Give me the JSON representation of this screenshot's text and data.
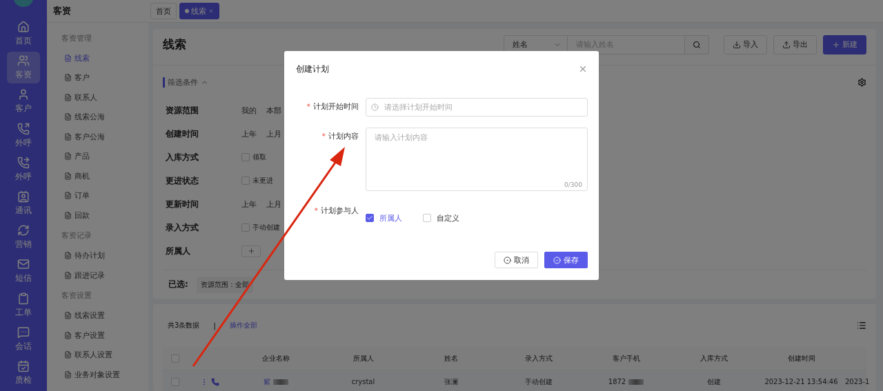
{
  "nav": [
    {
      "label": "首页",
      "selected": false
    },
    {
      "label": "客资",
      "selected": true
    },
    {
      "label": "客户",
      "selected": false
    },
    {
      "label": "外呼",
      "selected": false
    },
    {
      "label": "外呼",
      "selected": false
    },
    {
      "label": "通讯",
      "selected": false
    },
    {
      "label": "营销",
      "selected": false
    },
    {
      "label": "短信",
      "selected": false
    },
    {
      "label": "工单",
      "selected": false
    },
    {
      "label": "会话",
      "selected": false
    },
    {
      "label": "质检",
      "selected": false
    }
  ],
  "sidebar": {
    "title": "客资",
    "groups": [
      {
        "title": "客资管理",
        "items": [
          {
            "label": "线索",
            "selected": true
          },
          {
            "label": "客户",
            "selected": false
          },
          {
            "label": "联系人",
            "selected": false
          },
          {
            "label": "线索公海",
            "selected": false
          },
          {
            "label": "客户公海",
            "selected": false
          },
          {
            "label": "产品",
            "selected": false
          },
          {
            "label": "商机",
            "selected": false
          },
          {
            "label": "订单",
            "selected": false
          },
          {
            "label": "回款",
            "selected": false
          }
        ]
      },
      {
        "title": "客资记录",
        "items": [
          {
            "label": "待办计划",
            "selected": false
          },
          {
            "label": "跟进记录",
            "selected": false
          }
        ]
      },
      {
        "title": "客资设置",
        "items": [
          {
            "label": "线索设置",
            "selected": false
          },
          {
            "label": "客户设置",
            "selected": false
          },
          {
            "label": "联系人设置",
            "selected": false
          },
          {
            "label": "业务对象设置",
            "selected": false
          }
        ]
      }
    ]
  },
  "tabs": [
    {
      "label": "首页",
      "selected": false
    },
    {
      "label": "线索",
      "selected": true
    }
  ],
  "page": {
    "title": "线索",
    "search": {
      "field": "姓名",
      "placeholder": "请输入姓名"
    },
    "actions": [
      {
        "label": "导入",
        "kind": "import"
      },
      {
        "label": "导出",
        "kind": "export"
      },
      {
        "label": "新建",
        "kind": "new"
      }
    ]
  },
  "filters": {
    "title": "筛选条件",
    "expanded": true,
    "rows": [
      {
        "label": "资源范围",
        "kind": "options",
        "options": [
          {
            "label": "我的"
          },
          {
            "label": "本部"
          }
        ]
      },
      {
        "label": "创建时间",
        "kind": "options",
        "options": [
          {
            "label": "上年"
          },
          {
            "label": "上月"
          }
        ]
      },
      {
        "label": "入库方式",
        "kind": "checkbox",
        "options": [
          {
            "label": "领取",
            "checked": false
          }
        ]
      },
      {
        "label": "更进状态",
        "kind": "checkbox",
        "options": [
          {
            "label": "未更进",
            "checked": false
          }
        ]
      },
      {
        "label": "更新时间",
        "kind": "options",
        "options": [
          {
            "label": "上年"
          },
          {
            "label": "上月"
          }
        ]
      },
      {
        "label": "录入方式",
        "kind": "checkbox",
        "options": [
          {
            "label": "手动创建",
            "checked": false
          }
        ]
      },
      {
        "label": "所属人",
        "kind": "add"
      }
    ]
  },
  "chosen": {
    "label": "已选:",
    "tags": [
      "资源范围：全部"
    ]
  },
  "table": {
    "summary": "共3条数据",
    "separator": "|",
    "bulk_action": "操作全部",
    "all_checked": false,
    "columns": [
      {
        "label": "企业名称",
        "kind": "link-masked"
      },
      {
        "label": "所属人",
        "kind": "text"
      },
      {
        "label": "姓名",
        "kind": "text"
      },
      {
        "label": "录入方式",
        "kind": "text"
      },
      {
        "label": "客户手机",
        "kind": "masked"
      },
      {
        "label": "入库方式",
        "kind": "text"
      },
      {
        "label": "创建时间",
        "kind": "text"
      },
      {
        "kind": "text"
      }
    ],
    "rows": [
      {
        "checked": false,
        "cells": [
          "紫",
          "crystal",
          "张澜",
          "手动创建",
          "1872",
          "创建",
          "2023-12-21 13:54:46",
          "2023-1"
        ]
      }
    ]
  },
  "dialog": {
    "title": "创建计划",
    "required_mark": "*",
    "start": {
      "label": "计划开始时间",
      "required": true,
      "placeholder": "请选择计划开始时间"
    },
    "content": {
      "label": "计划内容",
      "required": true,
      "placeholder": "请输入计划内容",
      "counter": "0/300"
    },
    "participants": {
      "label": "计划参与人",
      "required": true,
      "options": [
        {
          "label": "所属人",
          "checked": true
        },
        {
          "label": "自定义",
          "checked": false
        }
      ]
    },
    "buttons": [
      {
        "label": "取消",
        "kind": "cancel"
      },
      {
        "label": "保存",
        "kind": "save"
      }
    ]
  }
}
